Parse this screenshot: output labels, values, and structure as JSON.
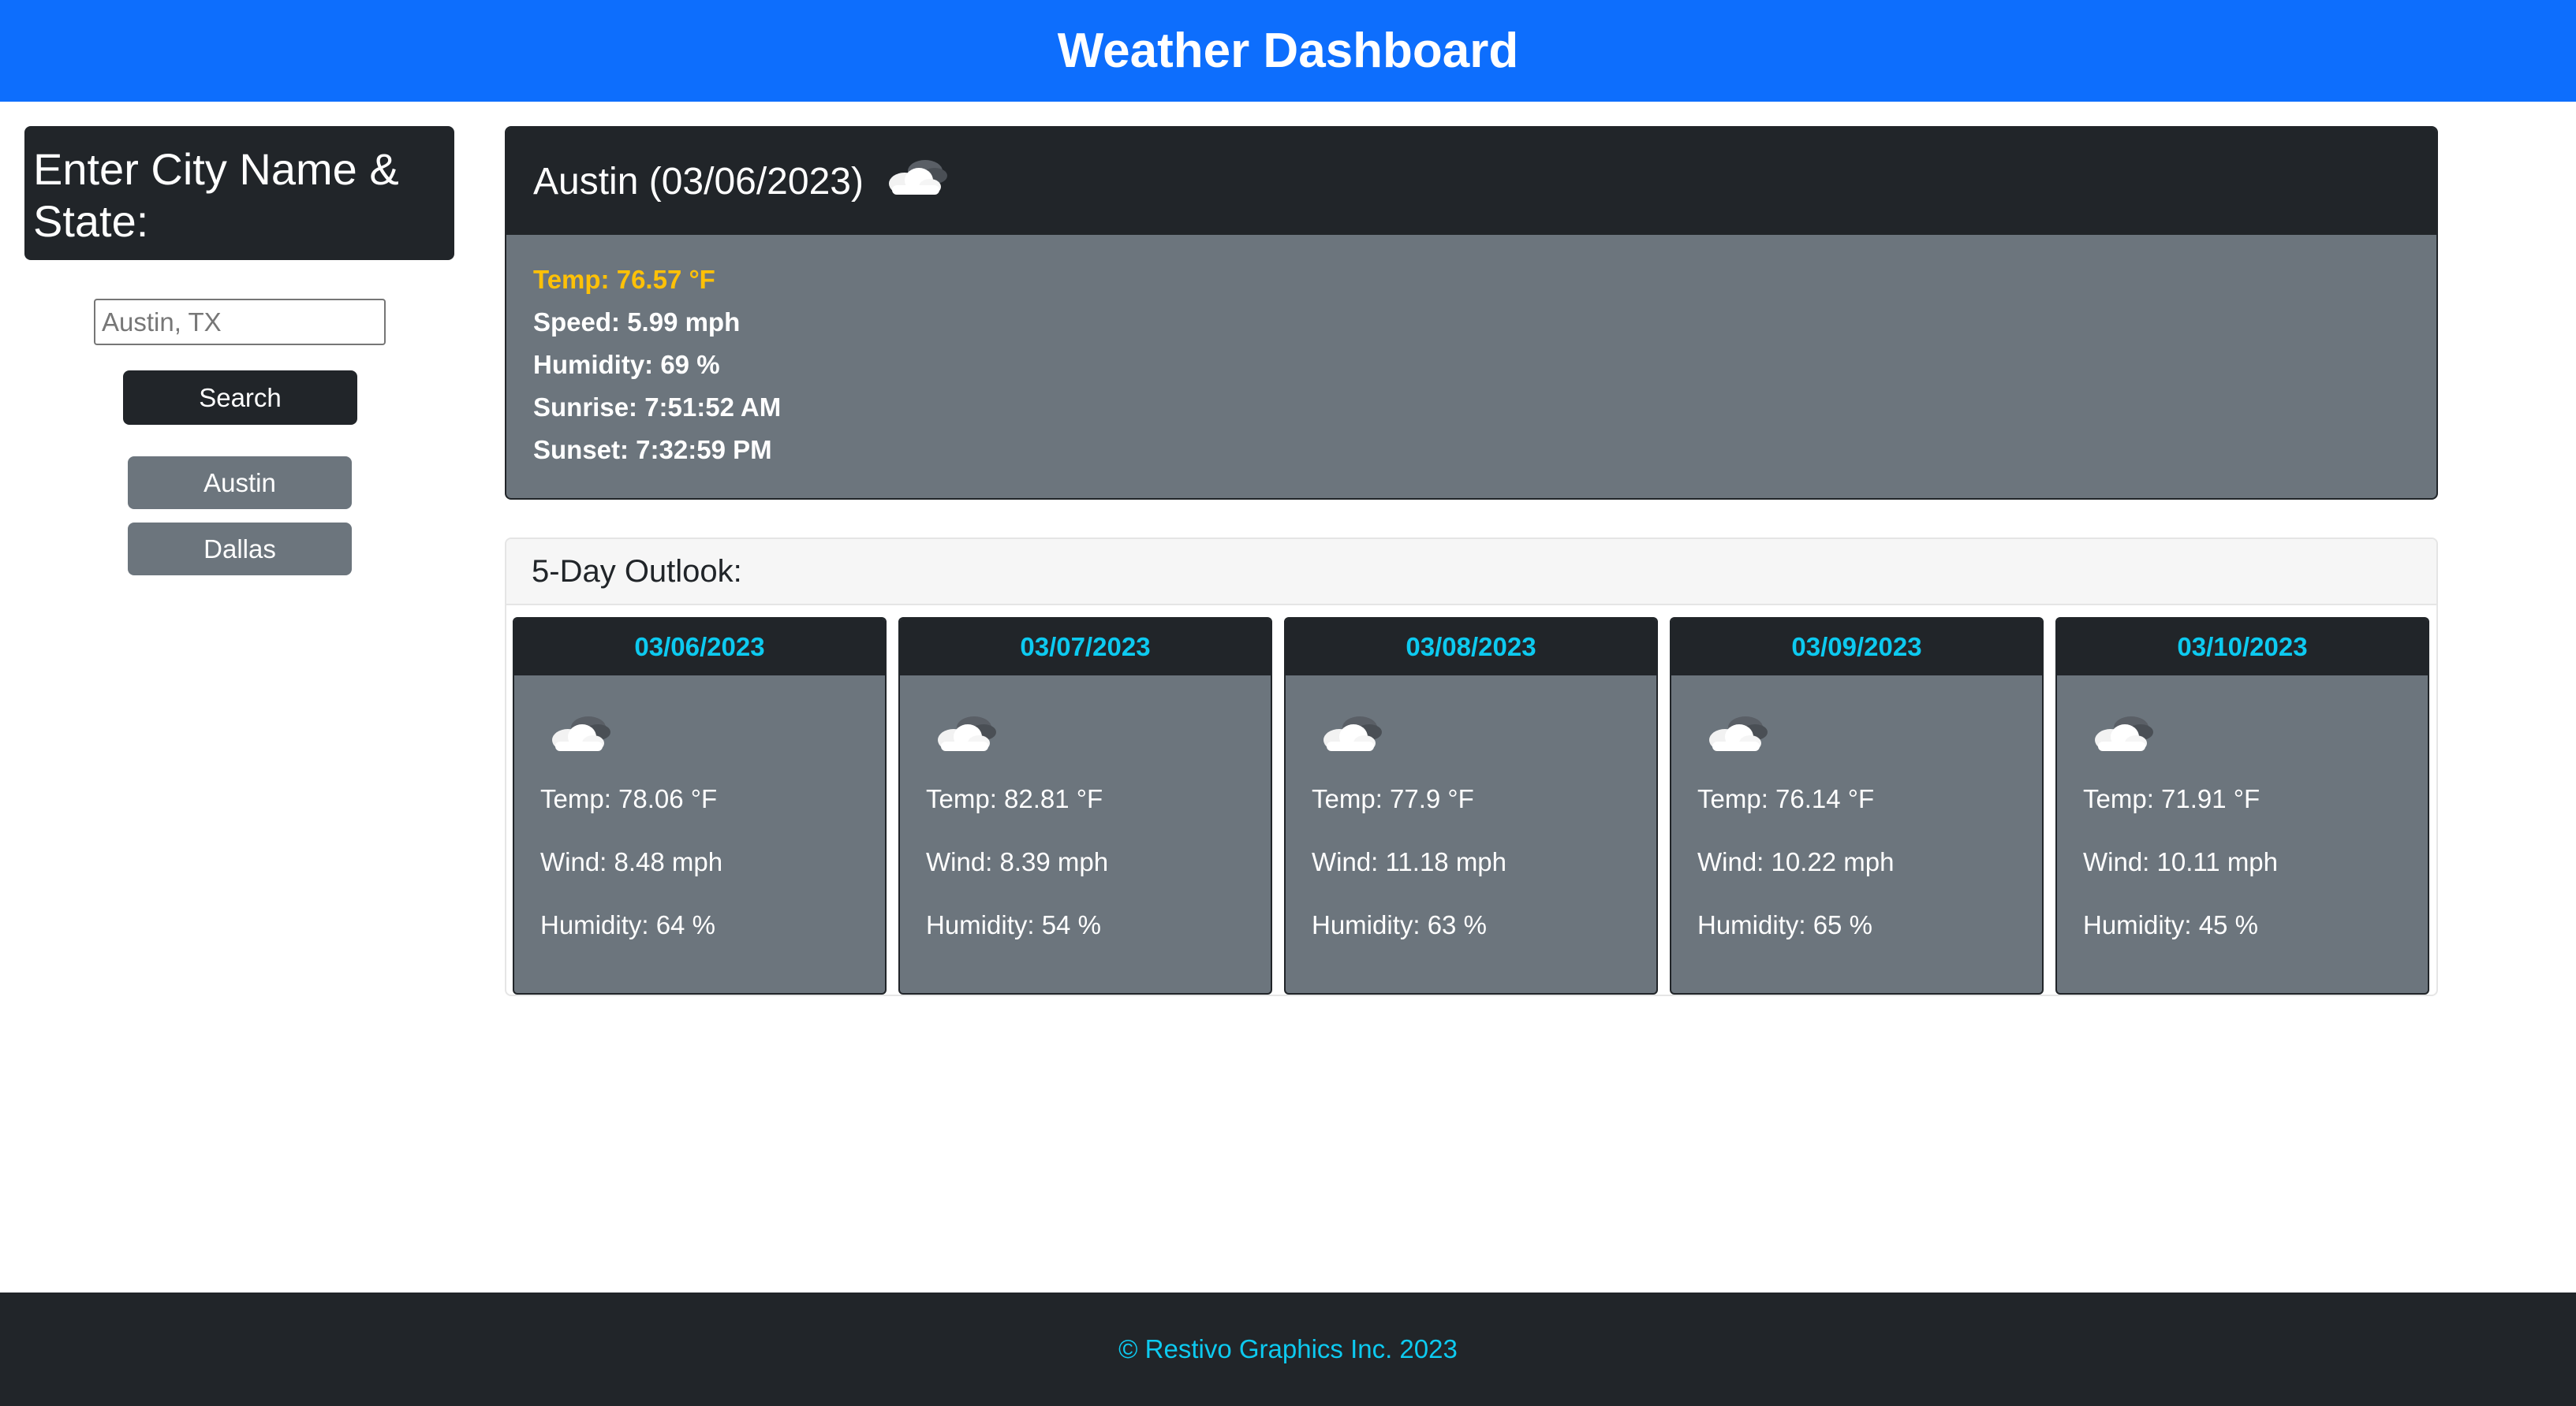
{
  "header": {
    "title": "Weather Dashboard"
  },
  "sidebar": {
    "title": "Enter City Name & State:",
    "search_input": {
      "value": "",
      "placeholder": "Austin, TX"
    },
    "search_label": "Search",
    "history": [
      "Austin",
      "Dallas"
    ]
  },
  "current": {
    "heading": "Austin (03/06/2023)",
    "icon": "cloud-icon",
    "temp": "Temp: 76.57 °F",
    "speed": "Speed: 5.99 mph",
    "humidity": "Humidity: 69 %",
    "sunrise": "Sunrise: 7:51:52 AM",
    "sunset": "Sunset: 7:32:59 PM"
  },
  "outlook": {
    "title": "5-Day Outlook:",
    "days": [
      {
        "date": "03/06/2023",
        "icon": "cloud-icon",
        "temp": "Temp: 78.06 °F",
        "wind": "Wind: 8.48 mph",
        "humidity": "Humidity: 64 %"
      },
      {
        "date": "03/07/2023",
        "icon": "cloud-icon",
        "temp": "Temp: 82.81 °F",
        "wind": "Wind: 8.39 mph",
        "humidity": "Humidity: 54 %"
      },
      {
        "date": "03/08/2023",
        "icon": "cloud-icon",
        "temp": "Temp: 77.9 °F",
        "wind": "Wind: 11.18 mph",
        "humidity": "Humidity: 63 %"
      },
      {
        "date": "03/09/2023",
        "icon": "cloud-icon",
        "temp": "Temp: 76.14 °F",
        "wind": "Wind: 10.22 mph",
        "humidity": "Humidity: 65 %"
      },
      {
        "date": "03/10/2023",
        "icon": "cloud-icon",
        "temp": "Temp: 71.91 °F",
        "wind": "Wind: 10.11 mph",
        "humidity": "Humidity: 45 %"
      }
    ]
  },
  "footer": {
    "text": "© Restivo Graphics Inc. 2023"
  },
  "colors": {
    "header_bg": "#0d6efd",
    "dark": "#212529",
    "secondary": "#6c757d",
    "temp_accent": "#ffc107",
    "date_accent": "#0dcaf0"
  }
}
